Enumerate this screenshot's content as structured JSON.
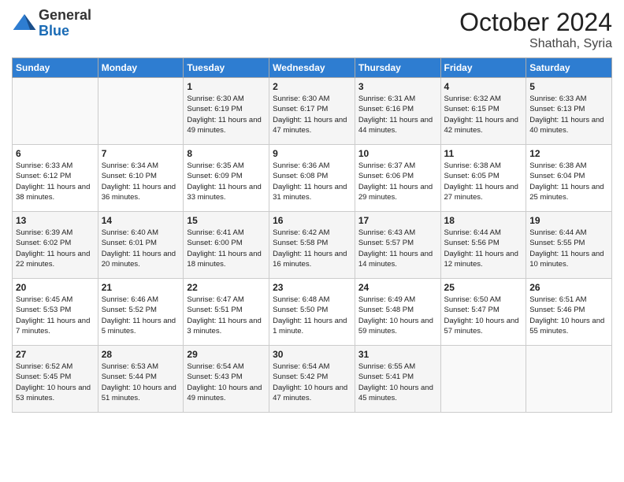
{
  "header": {
    "logo_general": "General",
    "logo_blue": "Blue",
    "month": "October 2024",
    "location": "Shathah, Syria"
  },
  "weekdays": [
    "Sunday",
    "Monday",
    "Tuesday",
    "Wednesday",
    "Thursday",
    "Friday",
    "Saturday"
  ],
  "weeks": [
    [
      {
        "day": "",
        "sunrise": "",
        "sunset": "",
        "daylight": ""
      },
      {
        "day": "",
        "sunrise": "",
        "sunset": "",
        "daylight": ""
      },
      {
        "day": "1",
        "sunrise": "Sunrise: 6:30 AM",
        "sunset": "Sunset: 6:19 PM",
        "daylight": "Daylight: 11 hours and 49 minutes."
      },
      {
        "day": "2",
        "sunrise": "Sunrise: 6:30 AM",
        "sunset": "Sunset: 6:17 PM",
        "daylight": "Daylight: 11 hours and 47 minutes."
      },
      {
        "day": "3",
        "sunrise": "Sunrise: 6:31 AM",
        "sunset": "Sunset: 6:16 PM",
        "daylight": "Daylight: 11 hours and 44 minutes."
      },
      {
        "day": "4",
        "sunrise": "Sunrise: 6:32 AM",
        "sunset": "Sunset: 6:15 PM",
        "daylight": "Daylight: 11 hours and 42 minutes."
      },
      {
        "day": "5",
        "sunrise": "Sunrise: 6:33 AM",
        "sunset": "Sunset: 6:13 PM",
        "daylight": "Daylight: 11 hours and 40 minutes."
      }
    ],
    [
      {
        "day": "6",
        "sunrise": "Sunrise: 6:33 AM",
        "sunset": "Sunset: 6:12 PM",
        "daylight": "Daylight: 11 hours and 38 minutes."
      },
      {
        "day": "7",
        "sunrise": "Sunrise: 6:34 AM",
        "sunset": "Sunset: 6:10 PM",
        "daylight": "Daylight: 11 hours and 36 minutes."
      },
      {
        "day": "8",
        "sunrise": "Sunrise: 6:35 AM",
        "sunset": "Sunset: 6:09 PM",
        "daylight": "Daylight: 11 hours and 33 minutes."
      },
      {
        "day": "9",
        "sunrise": "Sunrise: 6:36 AM",
        "sunset": "Sunset: 6:08 PM",
        "daylight": "Daylight: 11 hours and 31 minutes."
      },
      {
        "day": "10",
        "sunrise": "Sunrise: 6:37 AM",
        "sunset": "Sunset: 6:06 PM",
        "daylight": "Daylight: 11 hours and 29 minutes."
      },
      {
        "day": "11",
        "sunrise": "Sunrise: 6:38 AM",
        "sunset": "Sunset: 6:05 PM",
        "daylight": "Daylight: 11 hours and 27 minutes."
      },
      {
        "day": "12",
        "sunrise": "Sunrise: 6:38 AM",
        "sunset": "Sunset: 6:04 PM",
        "daylight": "Daylight: 11 hours and 25 minutes."
      }
    ],
    [
      {
        "day": "13",
        "sunrise": "Sunrise: 6:39 AM",
        "sunset": "Sunset: 6:02 PM",
        "daylight": "Daylight: 11 hours and 22 minutes."
      },
      {
        "day": "14",
        "sunrise": "Sunrise: 6:40 AM",
        "sunset": "Sunset: 6:01 PM",
        "daylight": "Daylight: 11 hours and 20 minutes."
      },
      {
        "day": "15",
        "sunrise": "Sunrise: 6:41 AM",
        "sunset": "Sunset: 6:00 PM",
        "daylight": "Daylight: 11 hours and 18 minutes."
      },
      {
        "day": "16",
        "sunrise": "Sunrise: 6:42 AM",
        "sunset": "Sunset: 5:58 PM",
        "daylight": "Daylight: 11 hours and 16 minutes."
      },
      {
        "day": "17",
        "sunrise": "Sunrise: 6:43 AM",
        "sunset": "Sunset: 5:57 PM",
        "daylight": "Daylight: 11 hours and 14 minutes."
      },
      {
        "day": "18",
        "sunrise": "Sunrise: 6:44 AM",
        "sunset": "Sunset: 5:56 PM",
        "daylight": "Daylight: 11 hours and 12 minutes."
      },
      {
        "day": "19",
        "sunrise": "Sunrise: 6:44 AM",
        "sunset": "Sunset: 5:55 PM",
        "daylight": "Daylight: 11 hours and 10 minutes."
      }
    ],
    [
      {
        "day": "20",
        "sunrise": "Sunrise: 6:45 AM",
        "sunset": "Sunset: 5:53 PM",
        "daylight": "Daylight: 11 hours and 7 minutes."
      },
      {
        "day": "21",
        "sunrise": "Sunrise: 6:46 AM",
        "sunset": "Sunset: 5:52 PM",
        "daylight": "Daylight: 11 hours and 5 minutes."
      },
      {
        "day": "22",
        "sunrise": "Sunrise: 6:47 AM",
        "sunset": "Sunset: 5:51 PM",
        "daylight": "Daylight: 11 hours and 3 minutes."
      },
      {
        "day": "23",
        "sunrise": "Sunrise: 6:48 AM",
        "sunset": "Sunset: 5:50 PM",
        "daylight": "Daylight: 11 hours and 1 minute."
      },
      {
        "day": "24",
        "sunrise": "Sunrise: 6:49 AM",
        "sunset": "Sunset: 5:48 PM",
        "daylight": "Daylight: 10 hours and 59 minutes."
      },
      {
        "day": "25",
        "sunrise": "Sunrise: 6:50 AM",
        "sunset": "Sunset: 5:47 PM",
        "daylight": "Daylight: 10 hours and 57 minutes."
      },
      {
        "day": "26",
        "sunrise": "Sunrise: 6:51 AM",
        "sunset": "Sunset: 5:46 PM",
        "daylight": "Daylight: 10 hours and 55 minutes."
      }
    ],
    [
      {
        "day": "27",
        "sunrise": "Sunrise: 6:52 AM",
        "sunset": "Sunset: 5:45 PM",
        "daylight": "Daylight: 10 hours and 53 minutes."
      },
      {
        "day": "28",
        "sunrise": "Sunrise: 6:53 AM",
        "sunset": "Sunset: 5:44 PM",
        "daylight": "Daylight: 10 hours and 51 minutes."
      },
      {
        "day": "29",
        "sunrise": "Sunrise: 6:54 AM",
        "sunset": "Sunset: 5:43 PM",
        "daylight": "Daylight: 10 hours and 49 minutes."
      },
      {
        "day": "30",
        "sunrise": "Sunrise: 6:54 AM",
        "sunset": "Sunset: 5:42 PM",
        "daylight": "Daylight: 10 hours and 47 minutes."
      },
      {
        "day": "31",
        "sunrise": "Sunrise: 6:55 AM",
        "sunset": "Sunset: 5:41 PM",
        "daylight": "Daylight: 10 hours and 45 minutes."
      },
      {
        "day": "",
        "sunrise": "",
        "sunset": "",
        "daylight": ""
      },
      {
        "day": "",
        "sunrise": "",
        "sunset": "",
        "daylight": ""
      }
    ]
  ]
}
